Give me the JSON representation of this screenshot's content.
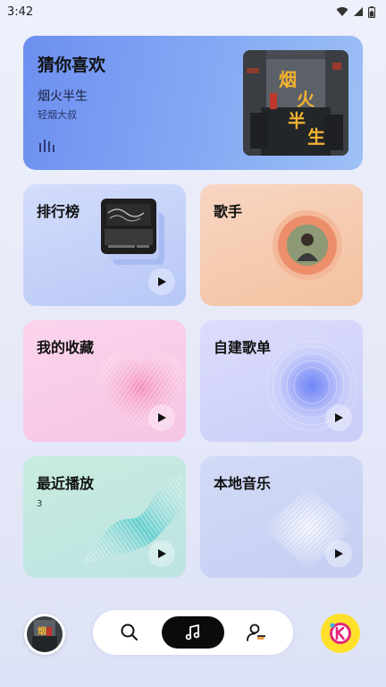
{
  "status_bar": {
    "time": "3:42"
  },
  "hero": {
    "title": "猜你喜欢",
    "song": "烟火半生",
    "artist": "轻烟大叔",
    "cover_text": "烟火半生",
    "accent": "#7a9bf2"
  },
  "cards": {
    "rank": {
      "title": "排行榜"
    },
    "singer": {
      "title": "歌手"
    },
    "favorites": {
      "title": "我的收藏"
    },
    "custom_playlist": {
      "title": "自建歌单"
    },
    "recent": {
      "title": "最近播放",
      "count": "3"
    },
    "local": {
      "title": "本地音乐"
    }
  },
  "bottom_nav": {
    "items": [
      {
        "icon": "search-icon"
      },
      {
        "icon": "music-note-icon",
        "active": true
      },
      {
        "icon": "user-settings-icon"
      }
    ],
    "kugou_color": "#ffe12c"
  }
}
